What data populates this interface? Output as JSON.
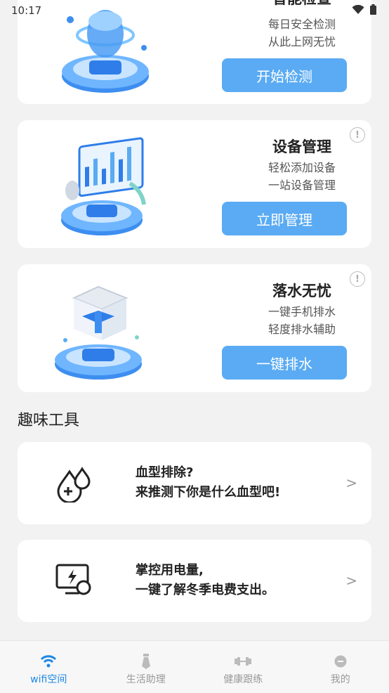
{
  "status_bar": {
    "time": "10:17"
  },
  "cards": [
    {
      "title": "智能检查",
      "line1": "每日安全检测",
      "line2": "从此上网无忧",
      "button": "开始检测"
    },
    {
      "title": "设备管理",
      "line1": "轻松添加设备",
      "line2": "一站设备管理",
      "button": "立即管理",
      "info": "!"
    },
    {
      "title": "落水无忧",
      "line1": "一键手机排水",
      "line2": "轻度排水辅助",
      "button": "一键排水",
      "info": "!"
    }
  ],
  "section": {
    "title": "趣味工具"
  },
  "tools": [
    {
      "line1": "血型排除?",
      "line2": "来推测下你是什么血型吧!",
      "chevron": ">"
    },
    {
      "line1": "掌控用电量,",
      "line2": "一键了解冬季电费支出。",
      "chevron": ">"
    }
  ],
  "tabbar": {
    "items": [
      {
        "label": "wifi空间",
        "active": true
      },
      {
        "label": "生活助理"
      },
      {
        "label": "健康跟练"
      },
      {
        "label": "我的"
      }
    ]
  },
  "colors": {
    "accent": "#5aabf3",
    "active_tab": "#1e88e5",
    "background": "#f2f2f2"
  }
}
